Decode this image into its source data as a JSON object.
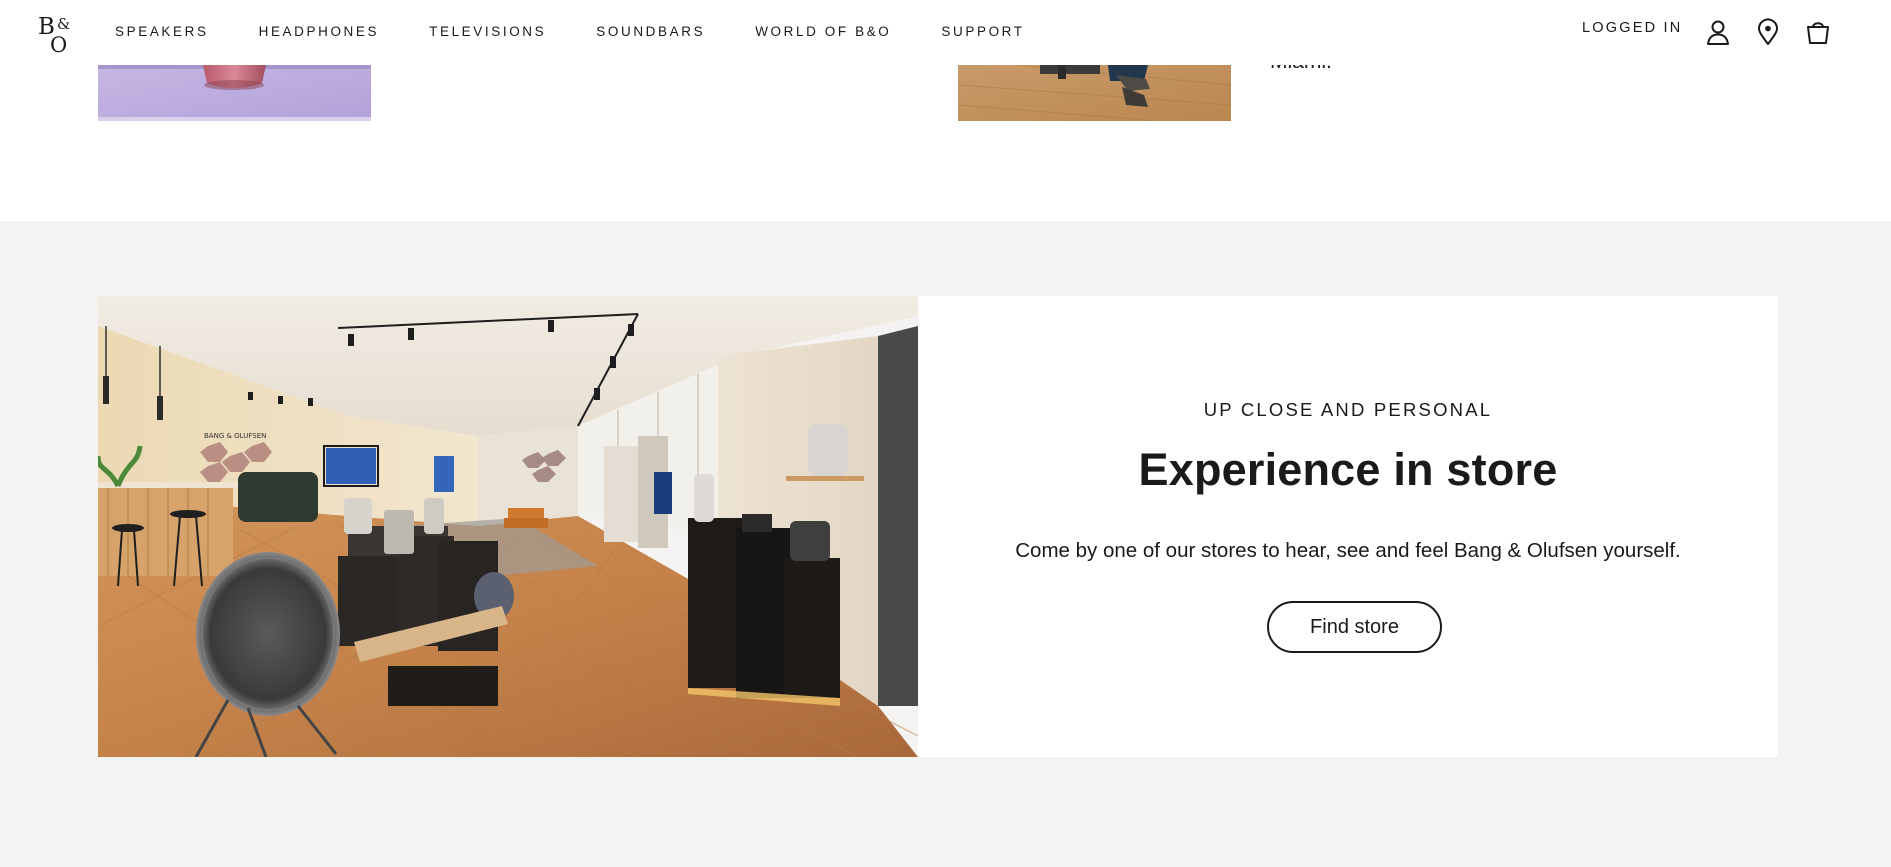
{
  "header": {
    "logo_alt": "B&O",
    "nav": [
      "SPEAKERS",
      "HEADPHONES",
      "TELEVISIONS",
      "SOUNDBARS",
      "WORLD OF B&O",
      "SUPPORT"
    ],
    "account_label": "LOGGED IN"
  },
  "top": {
    "partial_text": "Miami."
  },
  "store": {
    "eyebrow": "UP CLOSE AND PERSONAL",
    "title": "Experience in store",
    "description": "Come by one of our stores to hear, see and feel Bang & Olufsen yourself.",
    "button_label": "Find store",
    "sign_text": "BANG & OLUFSEN"
  },
  "colors": {
    "section_bg": "#f4f3f1",
    "text": "#1a1a1a",
    "card_bg": "#ffffff"
  }
}
